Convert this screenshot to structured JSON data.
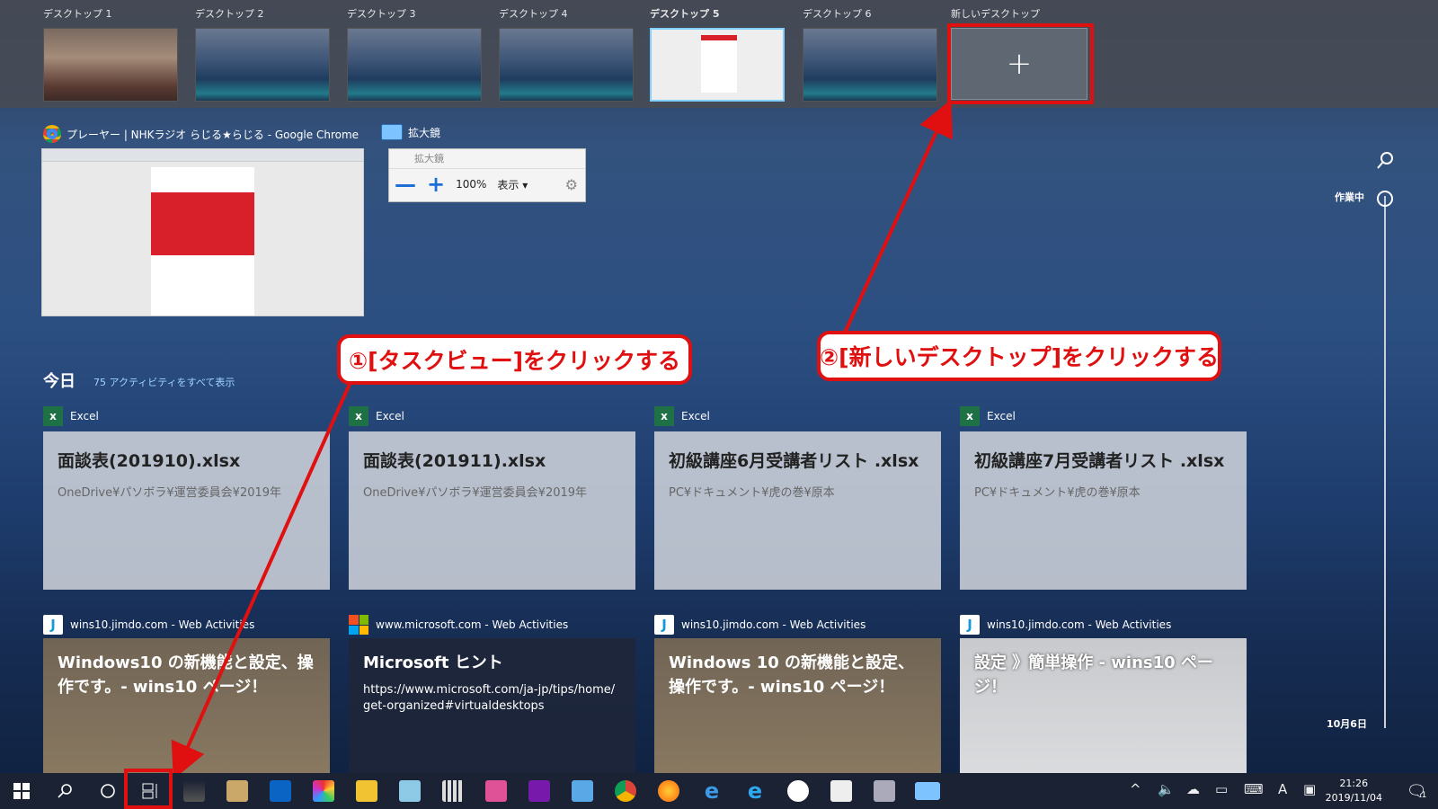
{
  "desktops": [
    {
      "label": "デスクトップ 1"
    },
    {
      "label": "デスクトップ 2"
    },
    {
      "label": "デスクトップ 3"
    },
    {
      "label": "デスクトップ 4"
    },
    {
      "label": "デスクトップ 5"
    },
    {
      "label": "デスクトップ 6"
    }
  ],
  "new_desktop": {
    "label": "新しいデスクトップ",
    "plus": "+"
  },
  "windows": {
    "chrome": {
      "title": "プレーヤー | NHKラジオ らじる★らじる - Google Chrome"
    },
    "magnifier": {
      "title": "拡大鏡",
      "inner_title": "拡大鏡",
      "minus": "—",
      "plus": "+",
      "zoom": "100%",
      "view": "表示 ▾"
    }
  },
  "timeline": {
    "today": "今日",
    "show_all": "75 アクティビティをすべて表示",
    "now_label": "作業中",
    "date_label": "10月6日",
    "excel_cards": [
      {
        "app": "Excel",
        "title": "面談表(201910).xlsx",
        "path": "OneDrive¥パソボラ¥運営委員会¥2019年"
      },
      {
        "app": "Excel",
        "title": "面談表(201911).xlsx",
        "path": "OneDrive¥パソボラ¥運営委員会¥2019年"
      },
      {
        "app": "Excel",
        "title": "初級講座6月受講者リスト .xlsx",
        "path": "PC¥ドキュメント¥虎の巻¥原本"
      },
      {
        "app": "Excel",
        "title": "初級講座7月受講者リスト .xlsx",
        "path": "PC¥ドキュメント¥虎の巻¥原本"
      }
    ],
    "web_cards": [
      {
        "source": "wins10.jimdo.com - Web Activities",
        "title": "Windows10 の新機能と設定、操作です。- wins10 ページ！",
        "url": ""
      },
      {
        "source": "www.microsoft.com - Web Activities",
        "title": "Microsoft ヒント",
        "url": "https://www.microsoft.com/ja-jp/tips/home/get-organized#virtualdesktops"
      },
      {
        "source": "wins10.jimdo.com - Web Activities",
        "title": "Windows 10 の新機能と設定、操作です。- wins10 ページ！",
        "url": ""
      },
      {
        "source": "wins10.jimdo.com - Web Activities",
        "title": "設定 》簡単操作 - wins10 ページ！",
        "url": ""
      }
    ]
  },
  "callouts": {
    "step1": "①[タスクビュー]をクリックする",
    "step2": "②[新しいデスクトップ]をクリックする"
  },
  "taskbar": {
    "icons": [
      "windows-start-icon",
      "search-icon",
      "cortana-icon",
      "task-view-icon",
      "sailing-icon",
      "explorer-folder-icon",
      "outlook-icon",
      "paint-icon",
      "file-explorer-icon",
      "word-pad-icon",
      "calculator-icon",
      "hdb-icon",
      "onenote-icon",
      "tv-icon",
      "chrome-icon",
      "firefox-icon",
      "edge-icon",
      "ie-icon",
      "photo-icon",
      "photos-icon",
      "screen-icon",
      "magnifier-icon"
    ],
    "tray": {
      "chevron": "^",
      "ime": "A"
    },
    "time": "21:26",
    "date": "2019/11/04",
    "notif_count": "1"
  },
  "colors": {
    "callout_red": "#e01010",
    "excel_green": "#1e7145",
    "taskbar": "#1b2233"
  }
}
